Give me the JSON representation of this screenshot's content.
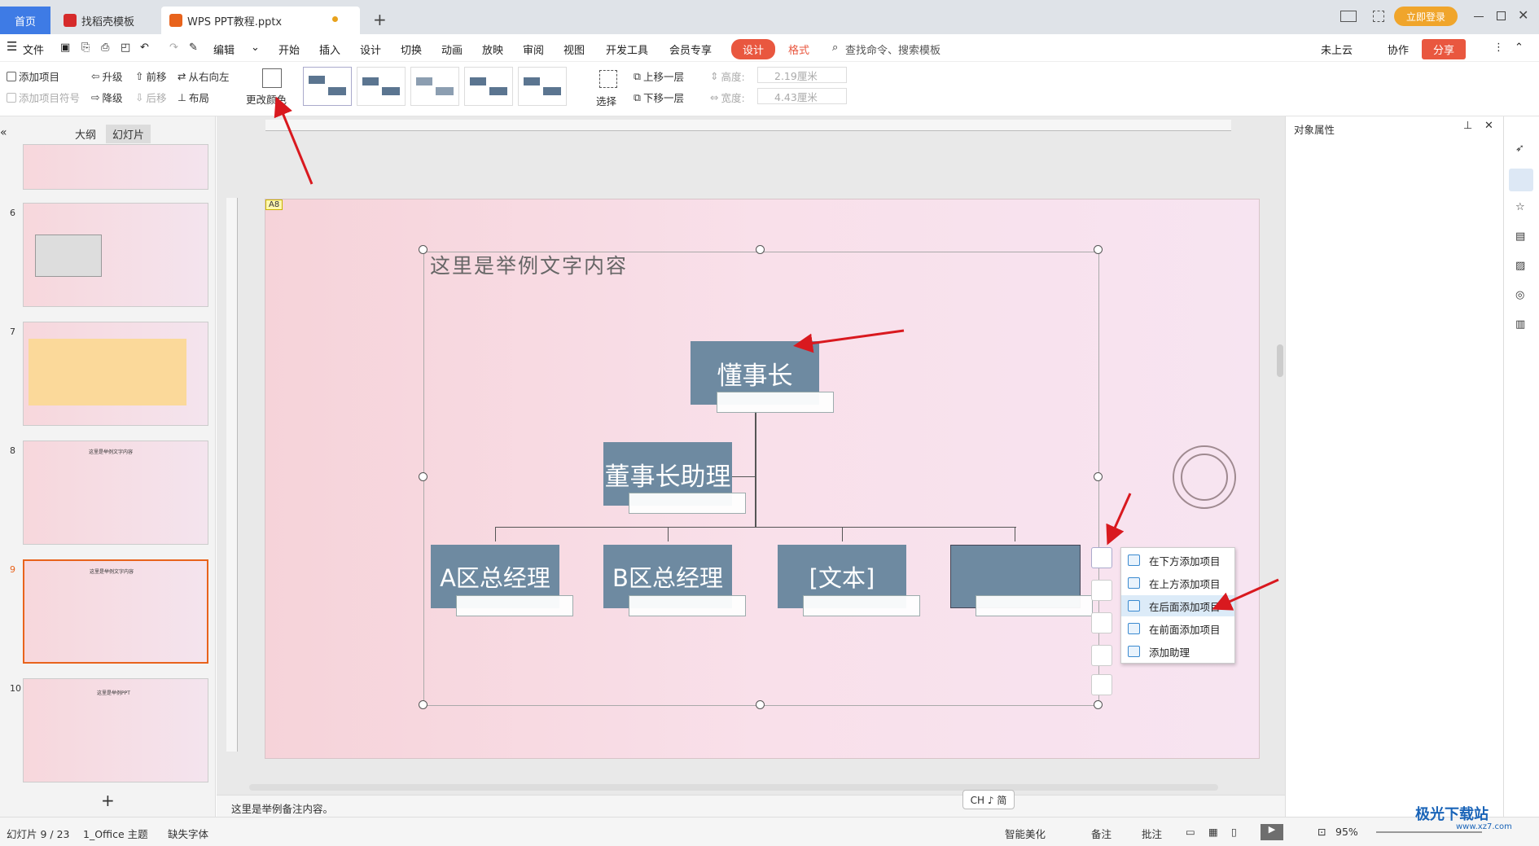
{
  "tabs": {
    "home": "首页",
    "templates": "找稻壳模板",
    "doc": "WPS PPT教程.pptx",
    "add": "+"
  },
  "window": {
    "login": "立即登录"
  },
  "menubar": {
    "file": "文件",
    "edit": "编辑",
    "items": [
      "开始",
      "插入",
      "设计",
      "切换",
      "动画",
      "放映",
      "审阅",
      "视图",
      "开发工具",
      "会员专享"
    ],
    "design_tab": "设计",
    "format_tab": "格式",
    "search": "查找命令、搜索模板",
    "cloud": "未上云",
    "collab": "协作",
    "share": "分享"
  },
  "ribbon": {
    "add_item": "添加项目",
    "add_bullet": "添加项目符号",
    "promote": "升级",
    "demote": "降级",
    "move_forward": "前移",
    "move_back": "后移",
    "right_to_left": "从右向左",
    "layout": "布局",
    "change_color": "更改颜色",
    "select": "选择",
    "bring_forward": "上移一层",
    "send_backward": "下移一层",
    "height_label": "高度:",
    "height_value": "2.19厘米",
    "width_label": "宽度:",
    "width_value": "4.43厘米"
  },
  "leftpanel": {
    "outline_tab": "大纲",
    "slides_tab": "幻灯片",
    "slide_numbers": [
      "6",
      "7",
      "8",
      "9",
      "10"
    ],
    "slide8_title": "这里是举例文字内容",
    "slide9_title": "这里是举例文字内容",
    "slide10_title": "这里是举例PPT",
    "add_slide": "+"
  },
  "slide": {
    "tag": "A8",
    "title": "这里是举例文字内容",
    "nodes": {
      "chairman": "懂事长",
      "assistant": "董事长助理",
      "a_manager": "A区总经理",
      "b_manager": "B区总经理",
      "text": "[文本]",
      "empty": ""
    }
  },
  "context_menu": {
    "items": [
      "在下方添加项目",
      "在上方添加项目",
      "在后面添加项目",
      "在前面添加项目",
      "添加助理"
    ]
  },
  "rightpanel": {
    "title": "对象属性"
  },
  "notes": {
    "text": "这里是举例备注内容。",
    "ime": "CH ♪ 简"
  },
  "status": {
    "slide_count": "幻灯片 9 / 23",
    "theme": "1_Office 主题",
    "missing_font": "缺失字体",
    "smart": "智能美化",
    "notes": "备注",
    "comments": "批注",
    "zoom": "95%"
  },
  "watermark": {
    "text": "极光下载站",
    "url": "www.xz7.com"
  },
  "colors": {
    "accent": "#3e7be5",
    "node": "#6e8aa1",
    "design_tab": "#e9573f",
    "arrow": "#d9191f"
  }
}
